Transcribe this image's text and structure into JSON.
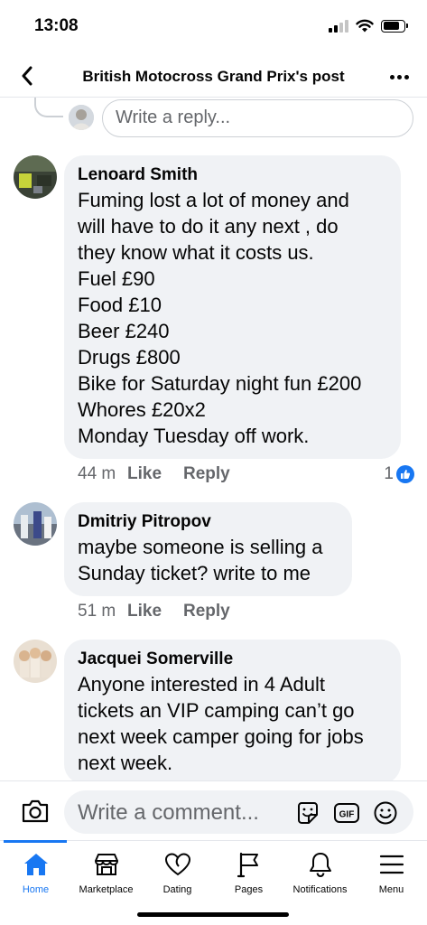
{
  "status_bar": {
    "time": "13:08"
  },
  "header": {
    "title": "British Motocross Grand Prix's post"
  },
  "reply_box": {
    "placeholder": "Write a reply..."
  },
  "comments": [
    {
      "author": "Lenoard Smith",
      "lines": [
        "Fuming lost a lot of money and",
        "will have to do it any next , do",
        "they know what it costs us.",
        "Fuel £90",
        "Food £10",
        "Beer £240",
        "Drugs £800",
        "Bike for Saturday night fun £200",
        "Whores £20x2",
        "Monday Tuesday off work."
      ],
      "time": "44 m",
      "like_label": "Like",
      "reply_label": "Reply",
      "reaction_count": "1"
    },
    {
      "author": "Dmitriy Pitropov",
      "lines": [
        "maybe someone is selling a",
        "Sunday ticket?  write to me"
      ],
      "time": "51 m",
      "like_label": "Like",
      "reply_label": "Reply"
    },
    {
      "author": "Jacquei Somerville",
      "lines": [
        "Anyone interested in 4 Adult",
        "tickets an VIP camping can’t go",
        "next week camper going for jobs",
        "next week."
      ]
    }
  ],
  "composer": {
    "placeholder": "Write a comment...",
    "gif_label": "GIF"
  },
  "tabs": [
    {
      "label": "Home",
      "icon": "home-icon",
      "active": true
    },
    {
      "label": "Marketplace",
      "icon": "marketplace-icon"
    },
    {
      "label": "Dating",
      "icon": "heart-icon"
    },
    {
      "label": "Pages",
      "icon": "flag-icon"
    },
    {
      "label": "Notifications",
      "icon": "bell-icon"
    },
    {
      "label": "Menu",
      "icon": "hamburger-icon"
    }
  ],
  "colors": {
    "accent": "#1877f2",
    "bubble": "#f0f2f5",
    "secondary_text": "#65676b"
  }
}
